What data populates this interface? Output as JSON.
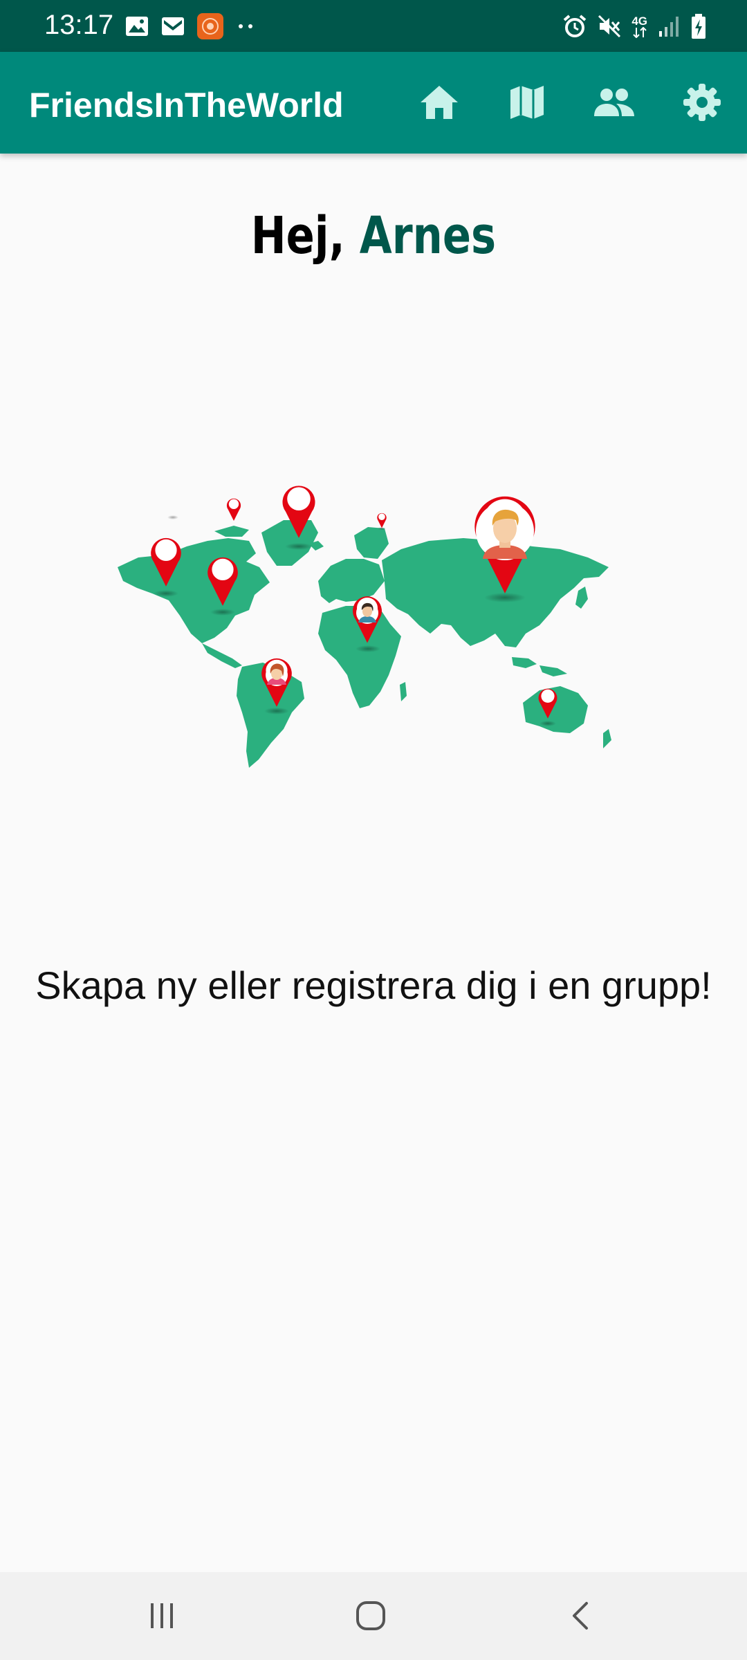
{
  "status_bar": {
    "time": "13:17",
    "left_icons": [
      "gallery-icon",
      "gmail-icon",
      "app-notification-icon",
      "more-notifications-icon"
    ],
    "right_icons": [
      "alarm-icon",
      "mute-icon",
      "network-4g-icon",
      "signal-icon",
      "battery-charging-icon"
    ],
    "network_label": "4G"
  },
  "app_bar": {
    "title": "FriendsInTheWorld",
    "actions": [
      "home-icon",
      "map-icon",
      "group-icon",
      "settings-icon"
    ]
  },
  "greeting": {
    "prefix": "Hej,",
    "name": "Arnes"
  },
  "illustration": {
    "icon": "world-map-with-pins-illustration",
    "map_color": "#2bb07f",
    "pin_color": "#e30613"
  },
  "cta": {
    "text": "Skapa ny eller registrera dig i en grupp!"
  },
  "nav_bar": {
    "buttons": [
      "recent-apps-icon",
      "home-nav-icon",
      "back-icon"
    ]
  },
  "colors": {
    "status_bar": "#00574b",
    "app_bar": "#00897b",
    "accent_name": "#00574b",
    "background": "#fafafa"
  }
}
